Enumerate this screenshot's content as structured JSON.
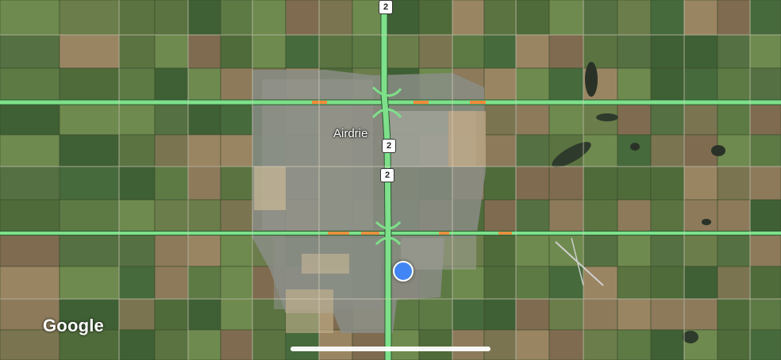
{
  "map": {
    "city_label": "Airdrie",
    "highway_shields": [
      "2",
      "2",
      "2"
    ],
    "logo": "Google",
    "location_dot_color": "#4285f4",
    "traffic_free_color": "#7ee08a",
    "traffic_slow_color": "#f08a3a",
    "view": "satellite"
  }
}
